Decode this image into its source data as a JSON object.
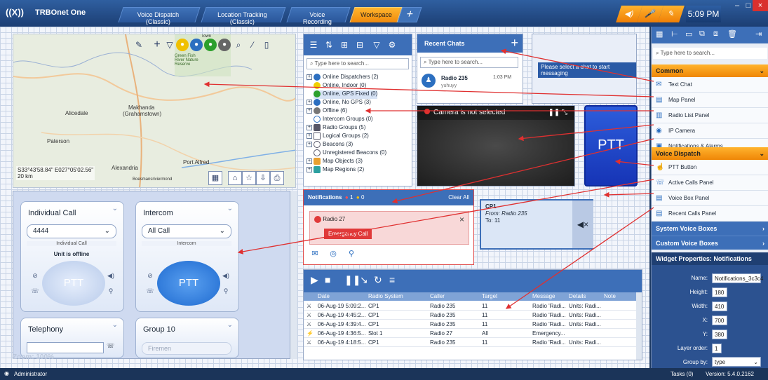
{
  "app": {
    "logo": "((X))",
    "name": "TRBOnet One",
    "time": "5:09 PM"
  },
  "tabs": [
    {
      "label": "Voice Dispatch (Classic)"
    },
    {
      "label": "Location Tracking (Classic)"
    },
    {
      "label": "Voice Recording"
    },
    {
      "label": "Workspace"
    }
  ],
  "map": {
    "coords": "S33°43'58.84\" E027°05'02.56\"",
    "scale": "20 km",
    "labels": [
      "Makhanda",
      "(Grahamstown)",
      "Alicedale",
      "Paterson",
      "Alexandria",
      "Port Alfred",
      "Boesmansriviermond",
      "Green Fish River Nature Reserve",
      "Town"
    ]
  },
  "radiolist": {
    "search": "Type here to search...",
    "rows": [
      "Online Dispatchers (2)",
      "Online, Indoor (0)",
      "Online, GPS Fixed (0)",
      "Online, No GPS (3)",
      "Offline (6)",
      "Intercom Groups (0)",
      "Radio Groups (5)",
      "Logical Groups (2)",
      "Beacons (3)",
      "Unregistered Beacons (0)",
      "Map Objects (3)",
      "Map Regions (2)"
    ]
  },
  "chats": {
    "title": "Recent Chats",
    "search": "Type here to search...",
    "name": "Radio 235",
    "time": "1:03 PM",
    "msg": "yuhuyy",
    "empty": "Please select a chat to start messaging"
  },
  "camera": {
    "text": "Camera is not selected",
    "ctl": "❚❚  ⤡"
  },
  "ptt": {
    "label": "PTT"
  },
  "notif": {
    "title": "Notifications",
    "red": "1",
    "yellow": "0",
    "clear": "Clear All",
    "radio": "Radio 27",
    "badge": "Emergency Call"
  },
  "cp1": {
    "title": "CP1",
    "from": "From: Radio 235",
    "to": "To:     11"
  },
  "calls": {
    "headers": [
      "Date",
      "Radio System",
      "Caller",
      "Target",
      "Message",
      "Details",
      "Note"
    ],
    "rows": [
      [
        "06-Aug-19 5:09:2...",
        "CP1",
        "Radio 235",
        "11",
        "Radio 'Radi...",
        "Units: Radi...",
        ""
      ],
      [
        "06-Aug-19 4:45:2...",
        "CP1",
        "Radio 235",
        "11",
        "Radio 'Radi...",
        "Units: Radi...",
        ""
      ],
      [
        "06-Aug-19 4:39:4...",
        "CP1",
        "Radio 235",
        "11",
        "Radio 'Radi...",
        "Units: Radi...",
        ""
      ],
      [
        "06-Aug-19 4:36:5...",
        "Slot 1",
        "Radio 27",
        "All",
        "Emergency...",
        "",
        ""
      ],
      [
        "06-Aug-19 4:18:5...",
        "CP1",
        "Radio 235",
        "11",
        "Radio 'Radi...",
        "Units: Radi...",
        ""
      ]
    ]
  },
  "cards": {
    "individual": {
      "title": "Individual Call",
      "value": "4444",
      "sub": "Individual Call",
      "status": "Unit is offline",
      "ptt": "PTT"
    },
    "intercom": {
      "title": "Intercom",
      "value": "All Call",
      "sub": "Intercom",
      "ptt": "PTT"
    },
    "telephony": {
      "title": "Telephony"
    },
    "group": {
      "title": "Group 10",
      "value": "Firemen"
    }
  },
  "zoom": "Zoom: 100%",
  "rpanel": {
    "search": "Type here to search...",
    "common": "Common",
    "commonItems": [
      "Text Chat",
      "Map Panel",
      "Radio List Panel",
      "IP Camera",
      "Notifications & Alarms"
    ],
    "voice": "Voice Dispatch",
    "voiceItems": [
      "PTT Button",
      "Active Calls Panel",
      "Voice Box Panel",
      "Recent Calls Panel"
    ],
    "sys": "System Voice Boxes",
    "custom": "Custom Voice Boxes",
    "wp": "Widget Properties: Notifications",
    "props": [
      {
        "k": "Name:",
        "v": "Notifications_3c3c4"
      },
      {
        "k": "Height:",
        "v": "180"
      },
      {
        "k": "Width:",
        "v": "410"
      },
      {
        "k": "X:",
        "v": "700"
      },
      {
        "k": "Y:",
        "v": "380"
      },
      {
        "k": "Layer order:",
        "v": "1"
      },
      {
        "k": "Group by:",
        "v": "type"
      }
    ]
  },
  "status": {
    "user": "Administrator",
    "tasks": "Tasks (0)",
    "version": "Version: 5.4.0.2162"
  },
  "colors": {
    "accent": "#3d6fb8",
    "orange": "#ef8606",
    "arrow": "#e03030"
  }
}
